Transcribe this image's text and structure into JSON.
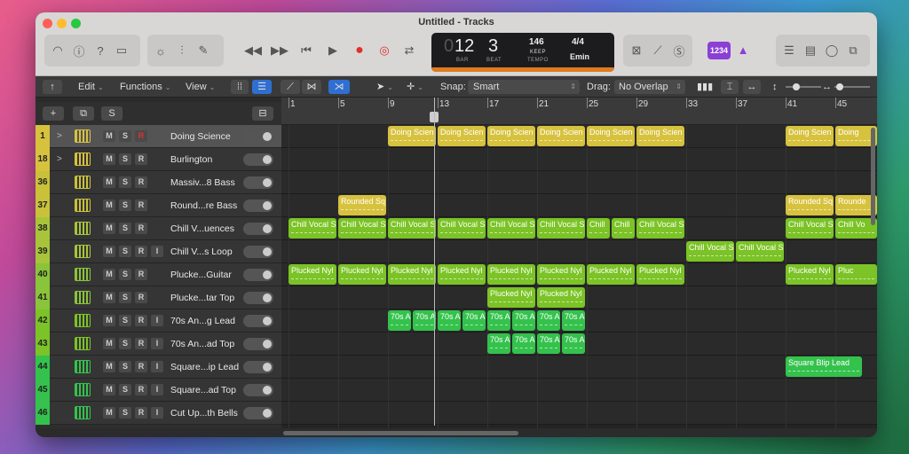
{
  "window": {
    "title": "Untitled - Tracks"
  },
  "lcd": {
    "bar": "12",
    "bar_label": "BAR",
    "beat": "3",
    "beat_label": "BEAT",
    "tempo": "146",
    "tempo_keep": "KEEP",
    "tempo_label": "TEMPO",
    "signature": "4/4",
    "key": "Emin",
    "bar_prefix": "0"
  },
  "count_in": "1234",
  "toolbar2": {
    "edit": "Edit",
    "functions": "Functions",
    "view": "View",
    "snap_label": "Snap:",
    "snap_value": "Smart",
    "drag_label": "Drag:",
    "drag_value": "No Overlap"
  },
  "header_buttons": {
    "s": "S"
  },
  "ruler": [
    "1",
    "5",
    "9",
    "13",
    "17",
    "21",
    "25",
    "29",
    "33",
    "37",
    "41",
    "45"
  ],
  "tracks": [
    {
      "num": "1",
      "name": "Doing Science",
      "buttons": [
        "M",
        "S",
        "R"
      ],
      "color": "#d7c23e",
      "icon": "summing-stack-icon",
      "disclosure": ">"
    },
    {
      "num": "18",
      "name": "Burlington",
      "buttons": [
        "M",
        "S",
        "R"
      ],
      "color": "#d7c23e",
      "icon": "summing-stack-icon",
      "disclosure": ">"
    },
    {
      "num": "36",
      "name": "Massiv...8 Bass",
      "buttons": [
        "M",
        "S",
        "R"
      ],
      "color": "#c9c13a",
      "icon": "keyboard-icon"
    },
    {
      "num": "37",
      "name": "Round...re Bass",
      "buttons": [
        "M",
        "S",
        "R"
      ],
      "color": "#c9c13a",
      "icon": "keyboard-icon"
    },
    {
      "num": "38",
      "name": "Chill V...uences",
      "buttons": [
        "M",
        "S",
        "R"
      ],
      "color": "#a7c43a",
      "icon": "keyboard-icon"
    },
    {
      "num": "39",
      "name": "Chill V...s Loop",
      "buttons": [
        "M",
        "S",
        "R",
        "I"
      ],
      "color": "#a7c43a",
      "icon": "keyboard-icon"
    },
    {
      "num": "40",
      "name": "Plucke...Guitar",
      "buttons": [
        "M",
        "S",
        "R"
      ],
      "color": "#8ac43a",
      "icon": "synth-icon"
    },
    {
      "num": "41",
      "name": "Plucke...tar Top",
      "buttons": [
        "M",
        "S",
        "R"
      ],
      "color": "#8ac43a",
      "icon": "synth-icon"
    },
    {
      "num": "42",
      "name": "70s An...g Lead",
      "buttons": [
        "M",
        "S",
        "R",
        "I"
      ],
      "color": "#7bc326",
      "icon": "synth-icon"
    },
    {
      "num": "43",
      "name": "70s An...ad Top",
      "buttons": [
        "M",
        "S",
        "R",
        "I"
      ],
      "color": "#7bc326",
      "icon": "synth-icon"
    },
    {
      "num": "44",
      "name": "Square...ip Lead",
      "buttons": [
        "M",
        "S",
        "R",
        "I"
      ],
      "color": "#34c24d",
      "icon": "keyboard-grid-icon"
    },
    {
      "num": "45",
      "name": "Square...ad Top",
      "buttons": [
        "M",
        "S",
        "R",
        "I"
      ],
      "color": "#34c24d",
      "icon": "keyboard-grid-icon"
    },
    {
      "num": "46",
      "name": "Cut Up...th Bells",
      "buttons": [
        "M",
        "S",
        "R",
        "I"
      ],
      "color": "#34c24d",
      "icon": "keyboard-grid-icon"
    }
  ],
  "regions": [
    {
      "row": 0,
      "bars": [
        9,
        13,
        17,
        21,
        25,
        29,
        41,
        45
      ],
      "len": 4,
      "label": "Doing Scien",
      "last_label": "Doing",
      "style": "yellow"
    },
    {
      "row": 3,
      "bars": [
        5,
        41,
        45
      ],
      "len": 4,
      "label": "Rounded Sq",
      "last_label": "Rounde",
      "style": "yellow"
    },
    {
      "row": 4,
      "bars": [
        1,
        5,
        9,
        13,
        17,
        21
      ],
      "len": 4,
      "label": "Chill Vocal S",
      "style": "lime"
    },
    {
      "row": 4,
      "bars": [
        25,
        27
      ],
      "len": 2,
      "label": "Chill",
      "style": "lime"
    },
    {
      "row": 4,
      "bars": [
        29,
        41,
        45
      ],
      "len": 4,
      "label": "Chill Vocal S",
      "last_label": "Chill Vo",
      "style": "lime"
    },
    {
      "row": 5,
      "bars": [
        33,
        37
      ],
      "len": 4,
      "label": "Chill Vocal S",
      "style": "lime"
    },
    {
      "row": 6,
      "bars": [
        1,
        5,
        9,
        13,
        17,
        21,
        25,
        29,
        41,
        45
      ],
      "len": 4,
      "label": "Plucked Nyl",
      "last_label": "Pluc",
      "style": "lime"
    },
    {
      "row": 7,
      "bars": [
        17,
        21
      ],
      "len": 4,
      "label": "Plucked Nyl",
      "style": "lime"
    },
    {
      "row": 8,
      "bars": [
        9,
        11,
        13,
        15,
        17,
        19,
        21,
        23
      ],
      "len": 2,
      "label": "70s A",
      "style": "green"
    },
    {
      "row": 9,
      "bars": [
        17,
        19,
        21,
        23
      ],
      "len": 2,
      "label": "70s A",
      "style": "green"
    },
    {
      "row": 10,
      "bars": [
        41
      ],
      "len": 6.3,
      "label": "Square Blip Lead",
      "style": "green"
    }
  ]
}
